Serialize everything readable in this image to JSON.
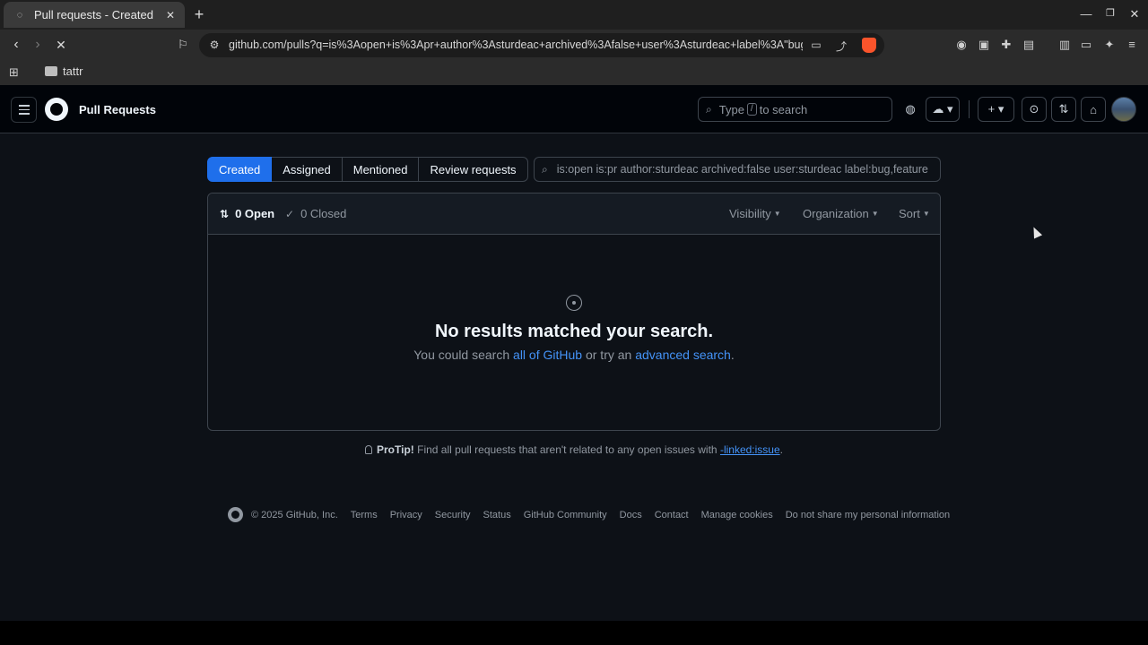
{
  "browser": {
    "tab_title": "Pull requests - Created",
    "tab_close": "✕",
    "new_tab": "+",
    "url": "github.com/pulls?q=is%3Aopen+is%3Apr+author%3Asturdeac+archived%3Afalse+user%3Asturdeac+label%3A\"bug%2...",
    "bookmark": "tattr"
  },
  "header": {
    "title": "Pull Requests",
    "search_placeholder_pre": "Type",
    "search_key": "/",
    "search_placeholder_post": "to search"
  },
  "tabs": [
    {
      "label": "Created",
      "active": true
    },
    {
      "label": "Assigned"
    },
    {
      "label": "Mentioned"
    },
    {
      "label": "Review requests"
    }
  ],
  "query": "is:open is:pr author:sturdeac archived:false user:sturdeac label:bug,feature",
  "list": {
    "open_label": "0 Open",
    "closed_label": "0 Closed",
    "filters": {
      "visibility": "Visibility",
      "organization": "Organization",
      "sort": "Sort"
    }
  },
  "blankslate": {
    "title": "No results matched your search.",
    "sub_pre": "You could search",
    "link1": "all of GitHub",
    "sub_mid": "or try an",
    "link2": "advanced search",
    "sub_end": "."
  },
  "protip": {
    "label": "ProTip!",
    "text": "Find all pull requests that aren't related to any open issues with",
    "link": "-linked:issue",
    "end": "."
  },
  "footer": {
    "copyright": "© 2025 GitHub, Inc.",
    "links": [
      "Terms",
      "Privacy",
      "Security",
      "Status",
      "GitHub Community",
      "Docs",
      "Contact",
      "Manage cookies",
      "Do not share my personal information"
    ]
  },
  "colors": {
    "accent": "#1f6feb",
    "link": "#4493f8",
    "bg": "#0d1117"
  }
}
